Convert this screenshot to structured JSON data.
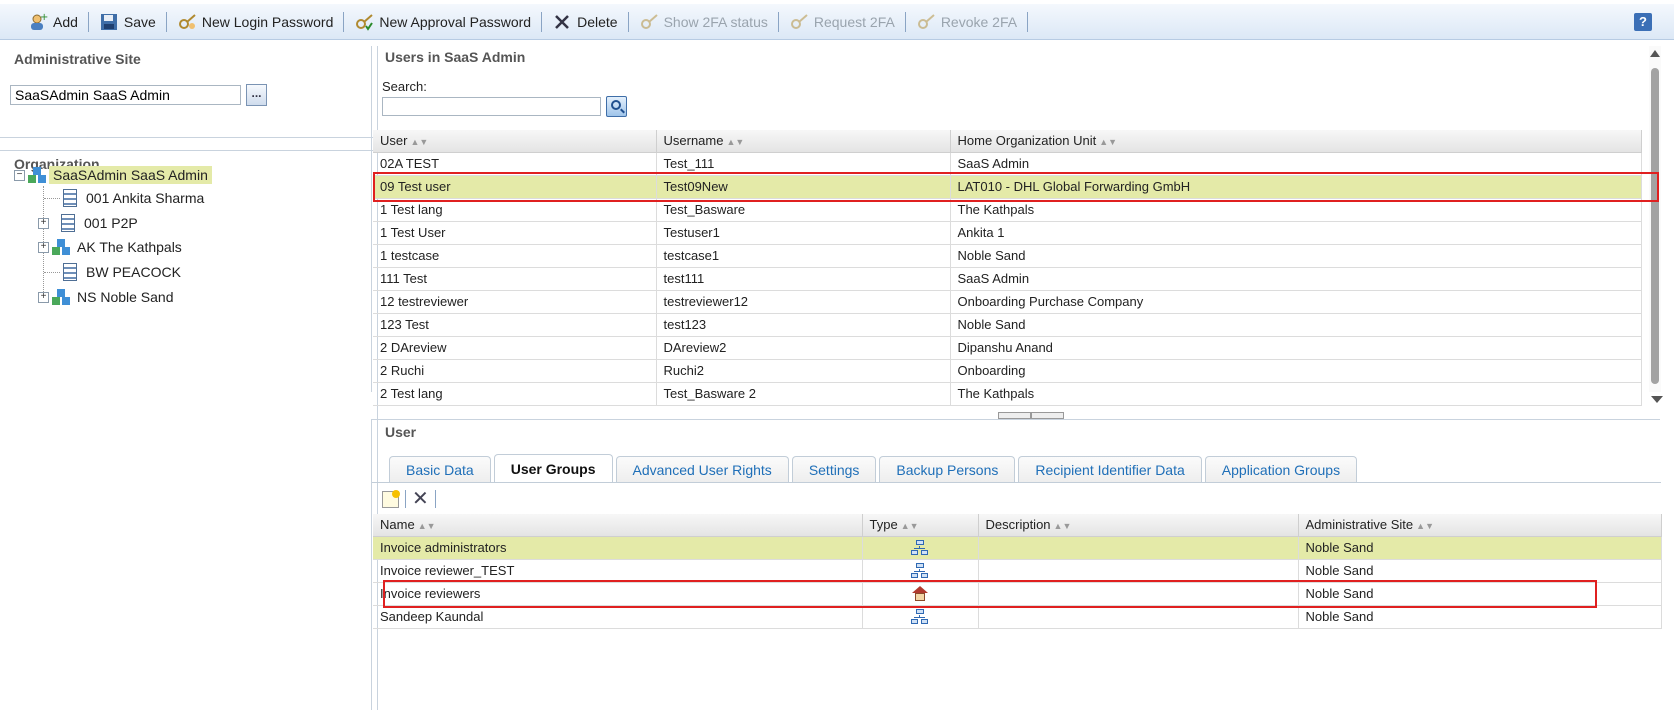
{
  "toolbar": {
    "add": "Add",
    "save": "Save",
    "new_login_password": "New Login Password",
    "new_approval_password": "New Approval Password",
    "delete": "Delete",
    "show_2fa": "Show 2FA status",
    "request_2fa": "Request 2FA",
    "revoke_2fa": "Revoke 2FA",
    "help": "?"
  },
  "admin_site": {
    "title": "Administrative Site",
    "value": "SaaSAdmin SaaS Admin",
    "browse": "..."
  },
  "organization": {
    "title": "Organization",
    "root": "SaaSAdmin SaaS Admin",
    "children": [
      "001 Ankita Sharma",
      "001 P2P",
      "AK The Kathpals",
      "BW PEACOCK",
      "NS Noble Sand"
    ]
  },
  "users_panel": {
    "title": "Users in SaaS Admin",
    "search_label": "Search:",
    "search_value": "",
    "columns": [
      "User",
      "Username",
      "Home Organization Unit"
    ],
    "rows": [
      [
        "02A TEST",
        "Test_111",
        "SaaS Admin"
      ],
      [
        "09 Test user",
        "Test09New",
        "LAT010 - DHL Global Forwarding GmbH"
      ],
      [
        "1 Test lang",
        "Test_Basware",
        "The Kathpals"
      ],
      [
        "1 Test User",
        "Testuser1",
        "Ankita 1"
      ],
      [
        "1 testcase",
        "testcase1",
        "Noble Sand"
      ],
      [
        "111 Test",
        "test111",
        "SaaS Admin"
      ],
      [
        "12 testreviewer",
        "testreviewer12",
        "Onboarding Purchase Company"
      ],
      [
        "123 Test",
        "test123",
        "Noble Sand"
      ],
      [
        "2 DAreview",
        "DAreview2",
        "Dipanshu Anand"
      ],
      [
        "2 Ruchi",
        "Ruchi2",
        "Onboarding"
      ],
      [
        "2 Test lang",
        "Test_Basware 2",
        "The Kathpals"
      ]
    ]
  },
  "user_panel": {
    "title": "User",
    "tabs": [
      "Basic Data",
      "User Groups",
      "Advanced User Rights",
      "Settings",
      "Backup Persons",
      "Recipient Identifier Data",
      "Application Groups"
    ],
    "columns": [
      "Name",
      "Type",
      "Description",
      "Administrative Site"
    ],
    "rows": [
      {
        "name": "Invoice administrators",
        "type": "group-hierarchy-icon",
        "description": "",
        "site": "Noble Sand"
      },
      {
        "name": "Invoice reviewer_TEST",
        "type": "group-hierarchy-icon",
        "description": "",
        "site": "Noble Sand"
      },
      {
        "name": "Invoice reviewers",
        "type": "home-icon",
        "description": "",
        "site": "Noble Sand"
      },
      {
        "name": "Sandeep Kaundal",
        "type": "group-hierarchy-icon",
        "description": "",
        "site": "Noble Sand"
      }
    ]
  },
  "colors": {
    "selection": "#e4eaa8",
    "highlight_box": "#e02020",
    "link": "#1f6fb8"
  }
}
